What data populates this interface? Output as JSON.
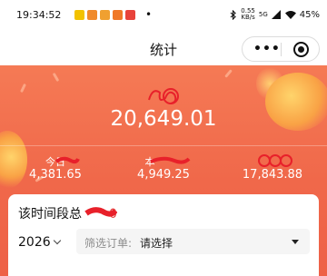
{
  "status_bar": {
    "time": "19:34:52",
    "dot": "•",
    "network_speed_value": "0.55",
    "network_speed_unit": "KB/s",
    "network_type": "5G",
    "battery": "45%"
  },
  "nav": {
    "title": "统计",
    "more_dots": "•••"
  },
  "summary": {
    "total_value": "20,649.01",
    "stats": [
      {
        "label": "今日",
        "value": "4,381.65"
      },
      {
        "label": "本",
        "value": "4,949.25"
      },
      {
        "label": "",
        "value": "17,843.88"
      }
    ]
  },
  "period": {
    "title": "该时间段总",
    "title_suffix": "0",
    "year": "2026",
    "filter_label": "筛选订单:",
    "filter_value": "请选择"
  },
  "colors": {
    "accent": "#f06a4b",
    "scribble": "#e8202a"
  }
}
